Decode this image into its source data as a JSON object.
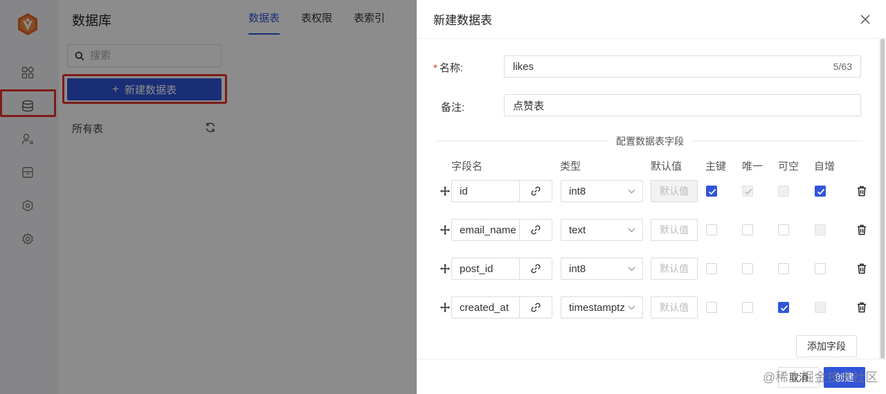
{
  "rail": {
    "logo_icon": "app-logo",
    "items": [
      {
        "icon": "grid-apps-icon"
      },
      {
        "icon": "database-icon",
        "active": true
      },
      {
        "icon": "user-list-icon"
      },
      {
        "icon": "storage-box-icon"
      },
      {
        "icon": "function-hex-icon"
      },
      {
        "icon": "settings-gear-icon"
      }
    ]
  },
  "sidebar": {
    "title": "数据库",
    "search_placeholder": "搜索",
    "new_table_label": "新建数据表",
    "all_tables_label": "所有表"
  },
  "tabs": [
    {
      "label": "数据表",
      "active": true
    },
    {
      "label": "表权限",
      "active": false
    },
    {
      "label": "表索引",
      "active": false
    }
  ],
  "drawer": {
    "title": "新建数据表",
    "name_label": "名称:",
    "name_value": "likes",
    "name_count": "5/63",
    "remark_label": "备注:",
    "remark_value": "点赞表",
    "section_title": "配置数据表字段",
    "columns": {
      "field_name": "字段名",
      "type": "类型",
      "default": "默认值",
      "primary": "主键",
      "unique": "唯一",
      "nullable": "可空",
      "auto_inc": "自增"
    },
    "default_placeholder": "默认值",
    "fields": [
      {
        "name": "id",
        "type": "int8",
        "primary": "checked",
        "unique": "disabled-checked",
        "nullable": "disabled",
        "auto_inc": "checked",
        "default_disabled": true
      },
      {
        "name": "email_name",
        "type": "text",
        "primary": "unchecked",
        "unique": "unchecked",
        "nullable": "unchecked",
        "auto_inc": "disabled",
        "default_disabled": false
      },
      {
        "name": "post_id",
        "type": "int8",
        "primary": "unchecked",
        "unique": "unchecked",
        "nullable": "unchecked",
        "auto_inc": "unchecked",
        "default_disabled": false
      },
      {
        "name": "created_at",
        "type": "timestamptz",
        "primary": "unchecked",
        "unique": "unchecked",
        "nullable": "checked",
        "auto_inc": "disabled",
        "default_disabled": false
      }
    ],
    "add_field_label": "添加字段",
    "cancel_label": "取消",
    "create_label": "创建",
    "watermark": "@稀土掘金技术社区"
  },
  "colors": {
    "primary": "#3155d9",
    "highlight": "#e5322d",
    "mask": "rgba(0,0,0,0.45)"
  }
}
